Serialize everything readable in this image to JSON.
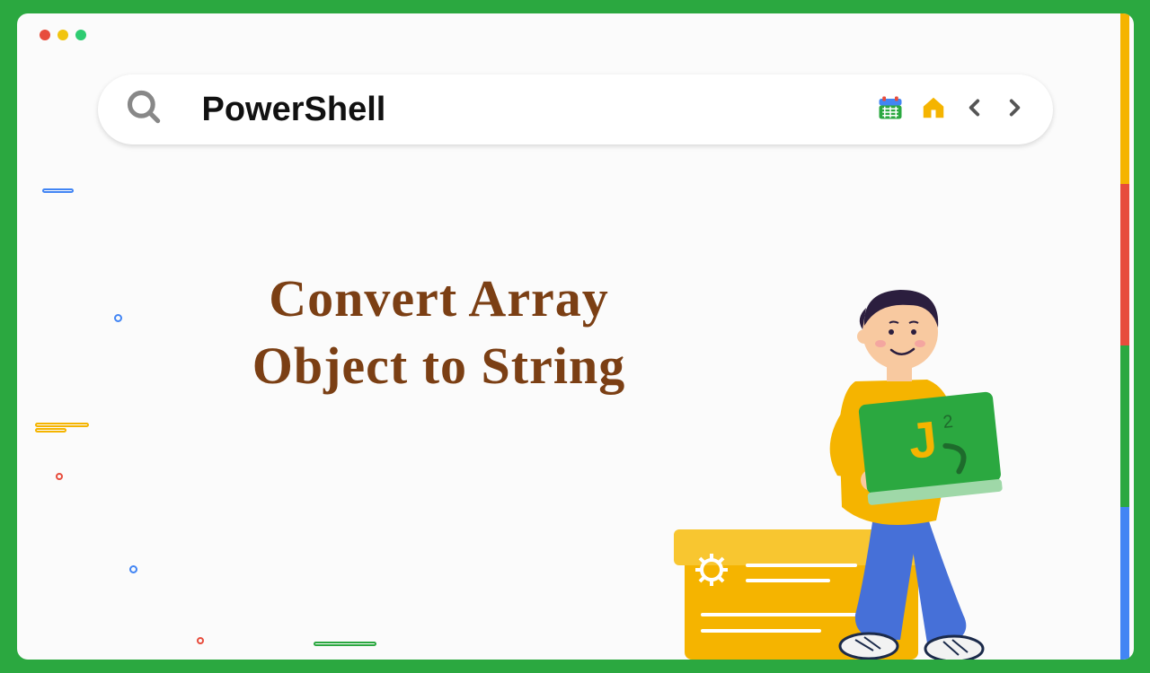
{
  "search": {
    "query": "PowerShell"
  },
  "title": {
    "line1": "Convert Array",
    "line2": "Object to String"
  },
  "laptop_logo": "J",
  "icons": {
    "calendar": "calendar-icon",
    "home": "home-icon",
    "prev": "chevron-left-icon",
    "next": "chevron-right-icon",
    "search": "search-icon"
  }
}
